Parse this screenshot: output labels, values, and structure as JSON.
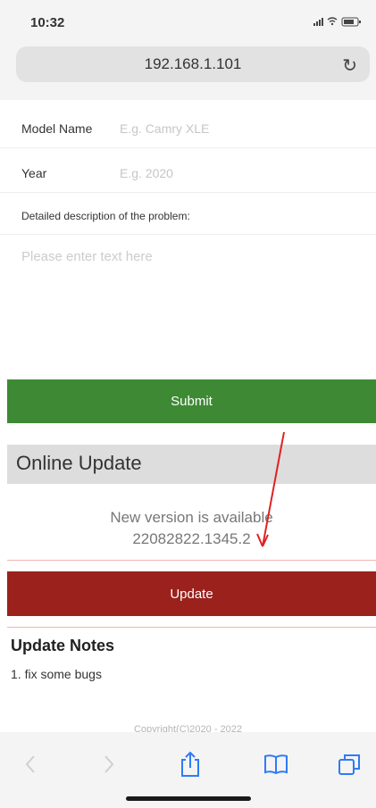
{
  "status_bar": {
    "time": "10:32",
    "indicators": "signal wifi battery"
  },
  "browser": {
    "url": "192.168.1.101",
    "reload_icon": "reload-icon"
  },
  "form": {
    "model_name": {
      "label": "Model Name",
      "placeholder": "E.g. Camry XLE"
    },
    "year": {
      "label": "Year",
      "placeholder": "E.g. 2020"
    },
    "description": {
      "label": "Detailed description of the problem:",
      "placeholder": "Please enter text here"
    },
    "submit_label": "Submit"
  },
  "online_update": {
    "title": "Online Update",
    "message_line1": "New version is available",
    "message_line2": "22082822.1345.2",
    "update_label": "Update"
  },
  "update_notes": {
    "title": "Update Notes",
    "items": [
      "1. fix some bugs"
    ]
  },
  "footer": {
    "copyright": "Copyright(C)2020 - 2022"
  },
  "toolbar": {
    "icons": [
      "back-icon",
      "forward-icon",
      "share-icon",
      "bookmarks-icon",
      "tabs-icon"
    ]
  },
  "colors": {
    "submit": "#3e8a34",
    "update": "#9b211c",
    "annotation_arrow": "#e02020"
  }
}
